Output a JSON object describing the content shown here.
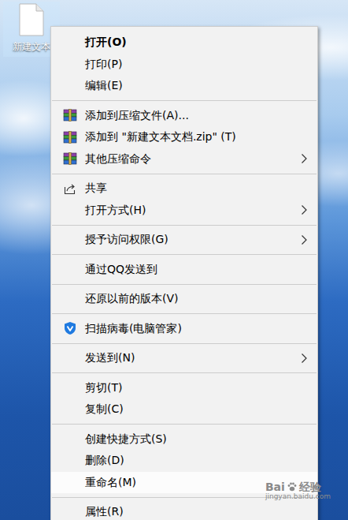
{
  "desktop": {
    "icon": {
      "label": "新建文本",
      "selected": true
    }
  },
  "menu": {
    "items": [
      {
        "kind": "item",
        "label": "打开(O)",
        "bold": true,
        "icon": null,
        "submenu": false,
        "selected": false
      },
      {
        "kind": "item",
        "label": "打印(P)",
        "bold": false,
        "icon": null,
        "submenu": false,
        "selected": false
      },
      {
        "kind": "item",
        "label": "编辑(E)",
        "bold": false,
        "icon": null,
        "submenu": false,
        "selected": false
      },
      {
        "kind": "separator"
      },
      {
        "kind": "item",
        "label": "添加到压缩文件(A)...",
        "bold": false,
        "icon": "archive",
        "submenu": false,
        "selected": false
      },
      {
        "kind": "item",
        "label": "添加到 \"新建文本文档.zip\" (T)",
        "bold": false,
        "icon": "archive",
        "submenu": false,
        "selected": false
      },
      {
        "kind": "item",
        "label": "其他压缩命令",
        "bold": false,
        "icon": "archive",
        "submenu": true,
        "selected": false
      },
      {
        "kind": "separator"
      },
      {
        "kind": "item",
        "label": "共享",
        "bold": false,
        "icon": "share",
        "submenu": false,
        "selected": false
      },
      {
        "kind": "item",
        "label": "打开方式(H)",
        "bold": false,
        "icon": null,
        "submenu": true,
        "selected": false
      },
      {
        "kind": "separator"
      },
      {
        "kind": "item",
        "label": "授予访问权限(G)",
        "bold": false,
        "icon": null,
        "submenu": true,
        "selected": false
      },
      {
        "kind": "separator"
      },
      {
        "kind": "item",
        "label": "通过QQ发送到",
        "bold": false,
        "icon": null,
        "submenu": false,
        "selected": false
      },
      {
        "kind": "separator"
      },
      {
        "kind": "item",
        "label": "还原以前的版本(V)",
        "bold": false,
        "icon": null,
        "submenu": false,
        "selected": false
      },
      {
        "kind": "separator"
      },
      {
        "kind": "item",
        "label": "扫描病毒(电脑管家)",
        "bold": false,
        "icon": "shield",
        "submenu": false,
        "selected": false
      },
      {
        "kind": "separator"
      },
      {
        "kind": "item",
        "label": "发送到(N)",
        "bold": false,
        "icon": null,
        "submenu": true,
        "selected": false
      },
      {
        "kind": "separator"
      },
      {
        "kind": "item",
        "label": "剪切(T)",
        "bold": false,
        "icon": null,
        "submenu": false,
        "selected": false
      },
      {
        "kind": "item",
        "label": "复制(C)",
        "bold": false,
        "icon": null,
        "submenu": false,
        "selected": false
      },
      {
        "kind": "separator"
      },
      {
        "kind": "item",
        "label": "创建快捷方式(S)",
        "bold": false,
        "icon": null,
        "submenu": false,
        "selected": false
      },
      {
        "kind": "item",
        "label": "删除(D)",
        "bold": false,
        "icon": null,
        "submenu": false,
        "selected": false
      },
      {
        "kind": "item",
        "label": "重命名(M)",
        "bold": false,
        "icon": null,
        "submenu": false,
        "selected": true
      },
      {
        "kind": "separator"
      },
      {
        "kind": "item",
        "label": "属性(R)",
        "bold": false,
        "icon": null,
        "submenu": false,
        "selected": false
      }
    ]
  },
  "watermark": {
    "brand": "Bai",
    "suffix": "经验",
    "url": "jingyan.baidu.com"
  }
}
